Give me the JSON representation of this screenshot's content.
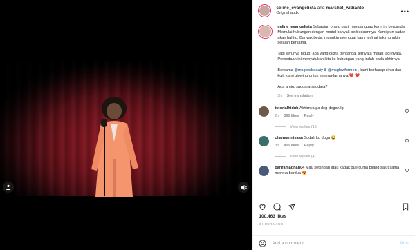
{
  "header": {
    "user1": "celine_evangelista",
    "joiner": "and",
    "user2": "marshel_widianto",
    "audio": "Original audio"
  },
  "caption": {
    "username": "celine_evangelista",
    "p1": "Sebagian orang pasti menganggap kami ini bercanda. Memulai hubungan dengan modal banyak perbedaannya. Kami pun sadar akan hal itu. Banyak beda, mungkin membuat kami terlihat tak mungkin sejalan bersama.",
    "p2": "Tapi serunya hidup, apa yang dikira bercanda, ternyata malah jadi nyata. Perbedaan ini menyatukan kita ke hubungan yang indah pada akhirnya.",
    "p3_prefix": "Bersama",
    "mention1": "@msglowbeauty",
    "p3_and": "&",
    "mention2": "@msglowformen",
    "p3_suffix": ", kami berharap cinta dan kulit kami glowing untuk selama-lamanya.",
    "hearts": "❤️ ❤️",
    "p4": "Ada amin, saudara-saudara?",
    "time": "3h",
    "see_translation": "See translation"
  },
  "comments": [
    {
      "username": "tutorialhidub",
      "text": "Akhirnya ga deg-degan lg",
      "time": "2h",
      "likes": "360 likes",
      "reply": "Reply",
      "view_replies": "View replies (15)"
    },
    {
      "username": "chairaannisaaa",
      "text": "Sudah ku duga 😂",
      "time": "3h",
      "likes": "405 likes",
      "reply": "Reply",
      "view_replies": "View replies (4)"
    },
    {
      "username": "danramadhan04",
      "text": "Mau settingan atau kagak gue cuma bilang salut sama mereka berdua 😍",
      "time": "",
      "likes": "",
      "reply": "",
      "view_replies": ""
    }
  ],
  "likes_count": "100,463 likes",
  "post_time": "3 HOURS AGO",
  "add_comment": {
    "placeholder": "Add a comment...",
    "post_label": "Post"
  },
  "colors": {
    "accent": "#0095f6",
    "heart": "#ed4956",
    "link": "#00376b",
    "curtain": "#8f1a24",
    "suit": "#f4956e"
  },
  "icons": {
    "more": "more-horizontal-icon",
    "heart": "heart-icon",
    "comment": "comment-icon",
    "share": "share-icon",
    "save": "bookmark-icon",
    "emoji": "emoji-icon",
    "user": "user-tag-icon",
    "mute": "mute-icon"
  }
}
